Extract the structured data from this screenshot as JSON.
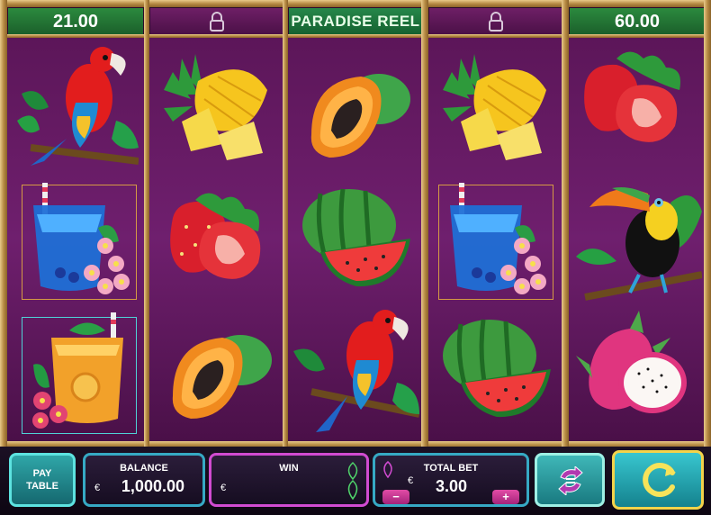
{
  "header": {
    "left_value": "21.00",
    "title": "PARADISE REEL",
    "right_value": "60.00",
    "lock_icons": [
      "lock-icon",
      "lock-icon"
    ]
  },
  "reels": [
    [
      "parrot",
      "blue-cocktail",
      "orange-cocktail"
    ],
    [
      "pineapple",
      "strawberry",
      "papaya"
    ],
    [
      "papaya",
      "watermelon",
      "parrot"
    ],
    [
      "pineapple",
      "blue-cocktail",
      "watermelon"
    ],
    [
      "strawberry",
      "toucan",
      "dragonfruit"
    ]
  ],
  "controls": {
    "pay_table_line1": "PAY",
    "pay_table_line2": "TABLE",
    "balance_label": "BALANCE",
    "balance_currency": "€",
    "balance_value": "1,000.00",
    "win_label": "WIN",
    "win_currency": "€",
    "total_bet_label": "TOTAL BET",
    "total_bet_currency": "€",
    "total_bet_value": "3.00",
    "minus_label": "−",
    "plus_label": "+",
    "autoplay_icon": "autoplay-icon",
    "spin_icon": "spin-icon"
  },
  "colors": {
    "background": "#6f1f6e",
    "value_panel": "#2b8a3e",
    "spin_border": "#f3d34a"
  }
}
